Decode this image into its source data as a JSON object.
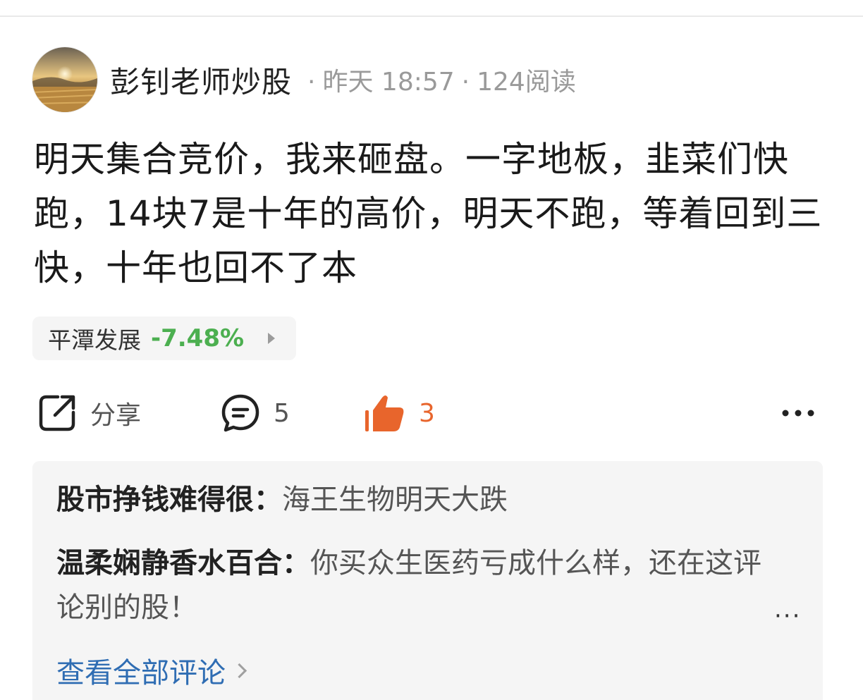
{
  "post": {
    "author": "彭钊老师炒股",
    "time": "昨天 18:57",
    "reads": "124阅读",
    "separator": "·",
    "content": "明天集合竞价，我来砸盘。一字地板，韭菜们快跑，14块7是十年的高价，明天不跑，等着回到三快，十年也回不了本"
  },
  "stock": {
    "name": "平潭发展",
    "change": "-7.48%",
    "change_color": "#4caf50"
  },
  "actions": {
    "share_label": "分享",
    "comment_count": "5",
    "like_count": "3",
    "like_color": "#e8652c",
    "more_icon": "more-horizontal-icon"
  },
  "comments": [
    {
      "name": "股市挣钱难得很",
      "text": "海王生物明天大跌"
    },
    {
      "name": "温柔娴静香水百合",
      "text": "你买众生医药亏成什么样，还在这评论别的股！"
    }
  ],
  "comment_separator": "：",
  "view_all_label": "查看全部评论",
  "colors": {
    "link": "#2f6db3",
    "muted": "#9a9a9a"
  }
}
